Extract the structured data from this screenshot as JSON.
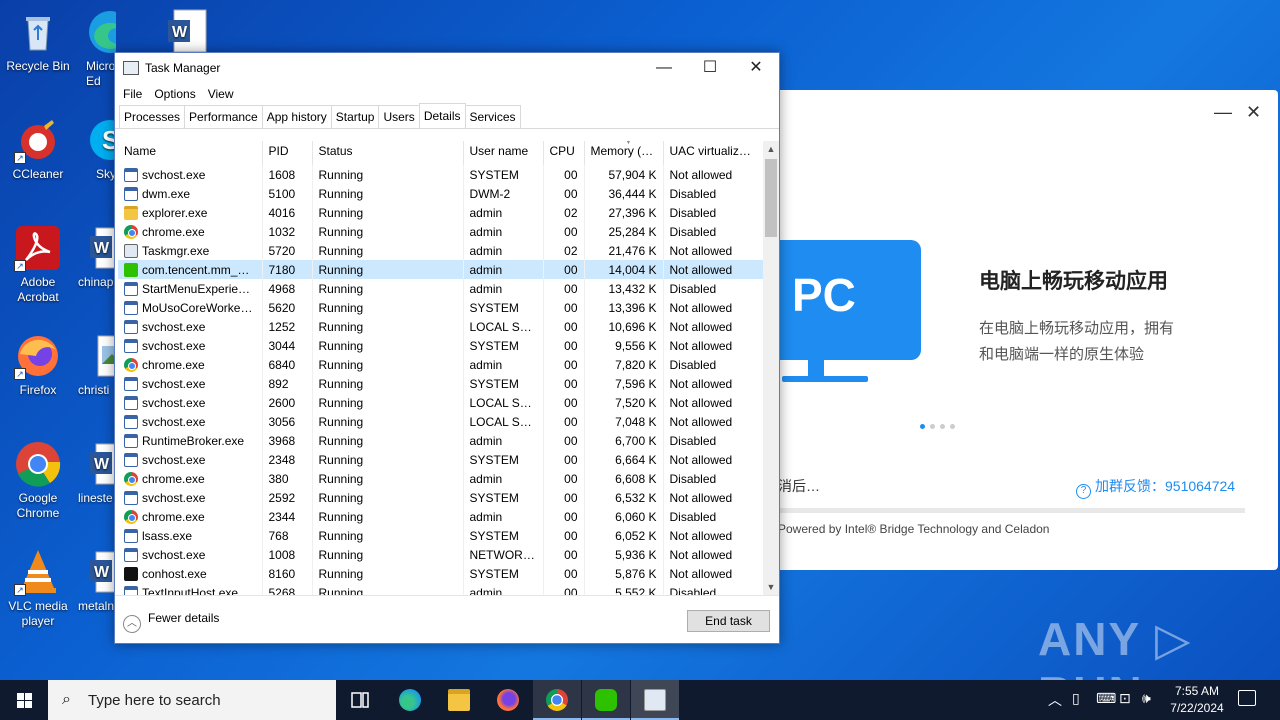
{
  "desktop": {
    "icons": [
      {
        "label": "Recycle Bin",
        "icon": "recycle-bin-icon"
      },
      {
        "label": "CCleaner",
        "icon": "ccleaner-icon"
      },
      {
        "label": "Adobe Acrobat",
        "icon": "adobe-acrobat-icon"
      },
      {
        "label": "Firefox",
        "icon": "firefox-icon"
      },
      {
        "label": "Google Chrome",
        "icon": "chrome-icon"
      },
      {
        "label": "VLC media player",
        "icon": "vlc-icon"
      }
    ],
    "partial_icons": [
      {
        "label": "Micro Ed",
        "icon": "edge-icon"
      },
      {
        "label": "Sky",
        "icon": "skype-icon"
      },
      {
        "label": "chinap",
        "icon": "word-doc-icon"
      },
      {
        "label": "christi",
        "icon": "image-file-icon"
      },
      {
        "label": "lineste",
        "icon": "word-doc-icon"
      },
      {
        "label": "metaln",
        "icon": "word-doc-icon"
      }
    ]
  },
  "background_app": {
    "pc_badge": "PC",
    "title": "电脑上畅玩移动应用",
    "description": "在电脑上畅玩移动应用，拥有和电脑端一样的原生体验",
    "cancel_text": "消后…",
    "feedback_label": "加群反馈：951064724",
    "powered_by": "Powered by Intel® Bridge Technology and Celadon",
    "minimize": "—",
    "close": "✕"
  },
  "watermark": "ANY ▷ RUN",
  "taskmanager": {
    "title": "Task Manager",
    "menu": [
      "File",
      "Options",
      "View"
    ],
    "tabs": [
      "Processes",
      "Performance",
      "App history",
      "Startup",
      "Users",
      "Details",
      "Services"
    ],
    "active_tab": "Details",
    "columns": [
      "Name",
      "PID",
      "Status",
      "User name",
      "CPU",
      "Memory (a...",
      "UAC virtualizat..."
    ],
    "rows": [
      {
        "icon": "win",
        "name": "svchost.exe",
        "pid": "1608",
        "status": "Running",
        "user": "SYSTEM",
        "cpu": "00",
        "mem": "57,904 K",
        "uac": "Not allowed"
      },
      {
        "icon": "win",
        "name": "dwm.exe",
        "pid": "5100",
        "status": "Running",
        "user": "DWM-2",
        "cpu": "00",
        "mem": "36,444 K",
        "uac": "Disabled"
      },
      {
        "icon": "folder",
        "name": "explorer.exe",
        "pid": "4016",
        "status": "Running",
        "user": "admin",
        "cpu": "02",
        "mem": "27,396 K",
        "uac": "Disabled"
      },
      {
        "icon": "chrome",
        "name": "chrome.exe",
        "pid": "1032",
        "status": "Running",
        "user": "admin",
        "cpu": "00",
        "mem": "25,284 K",
        "uac": "Disabled"
      },
      {
        "icon": "tm",
        "name": "Taskmgr.exe",
        "pid": "5720",
        "status": "Running",
        "user": "admin",
        "cpu": "02",
        "mem": "21,476 K",
        "uac": "Not allowed"
      },
      {
        "icon": "wechat",
        "name": "com.tencent.mm_27...",
        "pid": "7180",
        "status": "Running",
        "user": "admin",
        "cpu": "00",
        "mem": "14,004 K",
        "uac": "Not allowed",
        "selected": true
      },
      {
        "icon": "win",
        "name": "StartMenuExperienc...",
        "pid": "4968",
        "status": "Running",
        "user": "admin",
        "cpu": "00",
        "mem": "13,432 K",
        "uac": "Disabled"
      },
      {
        "icon": "win",
        "name": "MoUsoCoreWorker.e...",
        "pid": "5620",
        "status": "Running",
        "user": "SYSTEM",
        "cpu": "00",
        "mem": "13,396 K",
        "uac": "Not allowed"
      },
      {
        "icon": "win",
        "name": "svchost.exe",
        "pid": "1252",
        "status": "Running",
        "user": "LOCAL SE...",
        "cpu": "00",
        "mem": "10,696 K",
        "uac": "Not allowed"
      },
      {
        "icon": "win",
        "name": "svchost.exe",
        "pid": "3044",
        "status": "Running",
        "user": "SYSTEM",
        "cpu": "00",
        "mem": "9,556 K",
        "uac": "Not allowed"
      },
      {
        "icon": "chrome",
        "name": "chrome.exe",
        "pid": "6840",
        "status": "Running",
        "user": "admin",
        "cpu": "00",
        "mem": "7,820 K",
        "uac": "Disabled"
      },
      {
        "icon": "win",
        "name": "svchost.exe",
        "pid": "892",
        "status": "Running",
        "user": "SYSTEM",
        "cpu": "00",
        "mem": "7,596 K",
        "uac": "Not allowed"
      },
      {
        "icon": "win",
        "name": "svchost.exe",
        "pid": "2600",
        "status": "Running",
        "user": "LOCAL SE...",
        "cpu": "00",
        "mem": "7,520 K",
        "uac": "Not allowed"
      },
      {
        "icon": "win",
        "name": "svchost.exe",
        "pid": "3056",
        "status": "Running",
        "user": "LOCAL SE...",
        "cpu": "00",
        "mem": "7,048 K",
        "uac": "Not allowed"
      },
      {
        "icon": "win",
        "name": "RuntimeBroker.exe",
        "pid": "3968",
        "status": "Running",
        "user": "admin",
        "cpu": "00",
        "mem": "6,700 K",
        "uac": "Disabled"
      },
      {
        "icon": "win",
        "name": "svchost.exe",
        "pid": "2348",
        "status": "Running",
        "user": "SYSTEM",
        "cpu": "00",
        "mem": "6,664 K",
        "uac": "Not allowed"
      },
      {
        "icon": "chrome",
        "name": "chrome.exe",
        "pid": "380",
        "status": "Running",
        "user": "admin",
        "cpu": "00",
        "mem": "6,608 K",
        "uac": "Disabled"
      },
      {
        "icon": "win",
        "name": "svchost.exe",
        "pid": "2592",
        "status": "Running",
        "user": "SYSTEM",
        "cpu": "00",
        "mem": "6,532 K",
        "uac": "Not allowed"
      },
      {
        "icon": "chrome",
        "name": "chrome.exe",
        "pid": "2344",
        "status": "Running",
        "user": "admin",
        "cpu": "00",
        "mem": "6,060 K",
        "uac": "Disabled"
      },
      {
        "icon": "win",
        "name": "lsass.exe",
        "pid": "768",
        "status": "Running",
        "user": "SYSTEM",
        "cpu": "00",
        "mem": "6,052 K",
        "uac": "Not allowed"
      },
      {
        "icon": "win",
        "name": "svchost.exe",
        "pid": "1008",
        "status": "Running",
        "user": "NETWORK...",
        "cpu": "00",
        "mem": "5,936 K",
        "uac": "Not allowed"
      },
      {
        "icon": "con",
        "name": "conhost.exe",
        "pid": "8160",
        "status": "Running",
        "user": "SYSTEM",
        "cpu": "00",
        "mem": "5,876 K",
        "uac": "Not allowed"
      },
      {
        "icon": "win",
        "name": "TextInputHost.exe",
        "pid": "5268",
        "status": "Running",
        "user": "admin",
        "cpu": "00",
        "mem": "5,552 K",
        "uac": "Disabled"
      }
    ],
    "fewer_details": "Fewer details",
    "end_task": "End task"
  },
  "taskbar": {
    "search_placeholder": "Type here to search",
    "time": "7:55 AM",
    "date": "7/22/2024",
    "pinned": [
      "task-view-icon",
      "edge-icon",
      "file-explorer-icon",
      "firefox-icon",
      "chrome-icon",
      "wechat-icon",
      "task-manager-icon"
    ]
  },
  "colors": {
    "desktop_blue": "#0b5fd0",
    "selection": "#cce8ff",
    "app_accent": "#1e8cf0",
    "taskbar": "#101a2e"
  }
}
